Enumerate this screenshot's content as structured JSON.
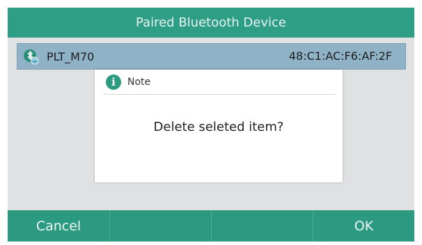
{
  "title": "Paired Bluetooth Device",
  "device": {
    "name": "PLT_M70",
    "mac": "48:C1:AC:F6:AF:2F",
    "icon": "bluetooth-headset-icon"
  },
  "dialog": {
    "title": "Note",
    "icon": "info-icon",
    "info_glyph": "i",
    "message": "Delete seleted item?"
  },
  "softkeys": [
    "Cancel",
    "",
    "",
    "OK"
  ],
  "colors": {
    "accent": "#2e9f85",
    "selected_row": "#8fb2c7",
    "background": "#dfe1e2"
  }
}
